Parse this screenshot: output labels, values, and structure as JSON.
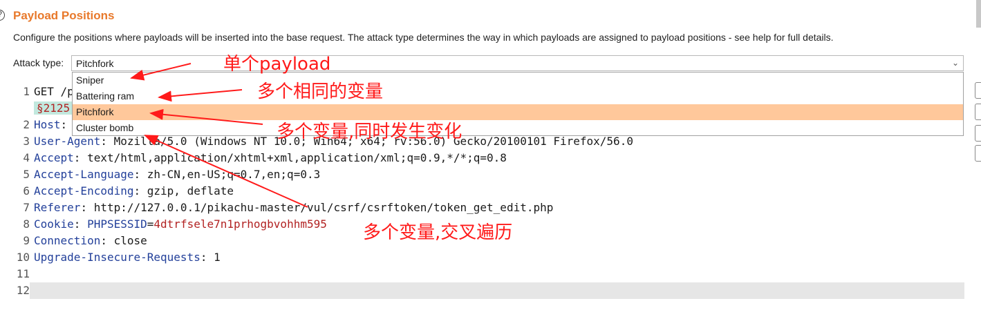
{
  "panel": {
    "title": "Payload Positions",
    "description": "Configure the positions where payloads will be inserted into the base request. The attack type determines the way in which payloads are assigned to payload positions - see help for full details.",
    "attack_type_label": "Attack type:",
    "attack_type_value": "Pitchfork",
    "options": [
      "Sniper",
      "Battering ram",
      "Pitchfork",
      "Cluster bomb"
    ],
    "selected_option": "Pitchfork"
  },
  "request": {
    "line1": "GET /p",
    "marker": "§2125",
    "host_key": "Host",
    "ua_key": "User-Agent",
    "ua_val": "Mozilla/5.0 (Windows NT 10.0; Win64; x64; rv:56.0) Gecko/20100101 Firefox/56.0",
    "accept_key": "Accept",
    "accept_val": "text/html,application/xhtml+xml,application/xml;q=0.9,*/*;q=0.8",
    "lang_key": "Accept-Language",
    "lang_val": "zh-CN,en-US;q=0.7,en;q=0.3",
    "enc_key": "Accept-Encoding",
    "enc_val": "gzip, deflate",
    "ref_key": "Referer",
    "ref_val": "http://127.0.0.1/pikachu-master/vul/csrf/csrftoken/token_get_edit.php",
    "cookie_key": "Cookie",
    "cookie_name": "PHPSESSID",
    "cookie_val": "4dtrfsele7n1prhogbvohhm595",
    "conn_key": "Connection",
    "conn_val": "close",
    "uir_key": "Upgrade-Insecure-Requests",
    "uir_val": "1",
    "line_numbers": [
      "1",
      "2",
      "3",
      "4",
      "5",
      "6",
      "7",
      "8",
      "9",
      "10",
      "11",
      "12"
    ]
  },
  "annotations": {
    "sniper": "单个payload",
    "battering": "多个相同的变量",
    "pitchfork": "多个变量,同时发生变化",
    "cluster": "多个变量,交叉遍历"
  },
  "colors": {
    "accent": "#e8792b",
    "selected": "#ffc89b",
    "annotation": "#ff1a1a"
  }
}
